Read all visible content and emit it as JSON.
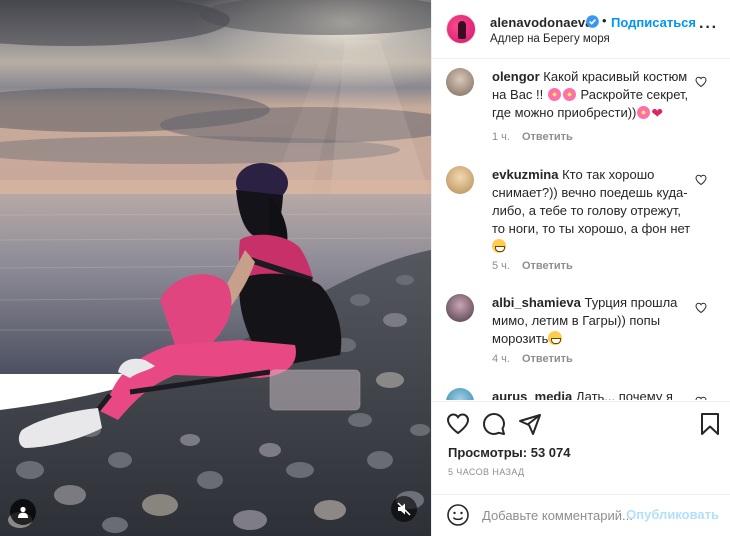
{
  "post": {
    "username": "alenavodonaeva",
    "follow_label": "Подписаться",
    "dot": "•",
    "location": "Адлер на Берегу моря",
    "more_icon": "more-horizontal-icon"
  },
  "comments": [
    {
      "username": "olengor",
      "text": "Какой красивый костюм на Вас !!",
      "text_after": "Раскройте секрет, где можно приобрести))",
      "time": "1 ч.",
      "reply": "Ответить"
    },
    {
      "username": "evkuzmina",
      "text": "Кто так хорошо снимает?)) вечно поедешь куда-либо, а тебе то голову отрежут, то ноги, то ты хорошо, а фон нет",
      "time": "5 ч.",
      "reply": "Ответить"
    },
    {
      "username": "albi_shamieva",
      "text": "Турция прошла мимо, летим в Гагры)) попы морозить",
      "time": "4 ч.",
      "reply": "Ответить"
    },
    {
      "username": "aurus_media",
      "text": "Дать... почему я это"
    }
  ],
  "stats": {
    "views_label": "Просмотры:",
    "views_value": "53 074",
    "time_ago": "5 ЧАСОВ НАЗАД"
  },
  "composer": {
    "placeholder": "Добавьте комментарий...",
    "publish_label": "Опубликовать"
  },
  "colors": {
    "accent": "#0095f6",
    "publish_disabled": "#b2dffc",
    "heart": "#e0245e",
    "verified": "#3897f0"
  }
}
